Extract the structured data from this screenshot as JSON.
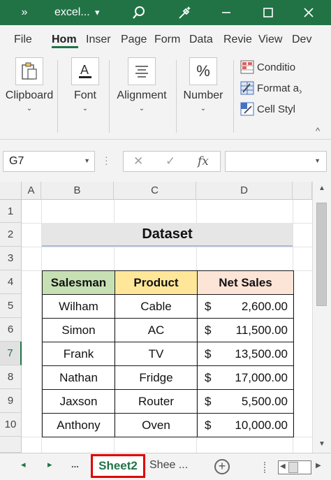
{
  "titlebar": {
    "overflow_glyph": "»",
    "filename": "excel...",
    "dropdown_glyph": "▾",
    "icons": [
      "search-icon",
      "wand-icon",
      "minimize-icon",
      "restore-icon",
      "close-icon"
    ]
  },
  "ribbon_tabs": [
    {
      "label": "File"
    },
    {
      "label": "Hom",
      "active": true
    },
    {
      "label": "Inser"
    },
    {
      "label": "Page"
    },
    {
      "label": "Form"
    },
    {
      "label": "Data"
    },
    {
      "label": "Revie"
    },
    {
      "label": "View"
    },
    {
      "label": "Dev"
    }
  ],
  "ribbon": {
    "clipboard": "Clipboard",
    "font": "Font",
    "alignment": "Alignment",
    "number": "Number",
    "number_symbol": "%",
    "conditional": "Conditio",
    "format_as": "Format a",
    "cell_styles": "Cell Styl",
    "collapse_glyph": "^",
    "expand_glyph": "›"
  },
  "formula_bar": {
    "name_box": "G7",
    "cancel_glyph": "✕",
    "enter_glyph": "✓",
    "fx_glyph": "fx",
    "formula_value": ""
  },
  "grid": {
    "columns": [
      "A",
      "B",
      "C",
      "D"
    ],
    "rows": [
      "1",
      "2",
      "3",
      "4",
      "5",
      "6",
      "7",
      "8",
      "9",
      "10"
    ],
    "selected_row": "7"
  },
  "dataset": {
    "title": "Dataset",
    "headers": [
      "Salesman",
      "Product",
      "Net Sales"
    ],
    "header_colors": [
      "#c6e0b4",
      "#ffe699",
      "#fce4d6"
    ],
    "currency_symbol": "$",
    "rows": [
      {
        "salesman": "Wilham",
        "product": "Cable",
        "net_sales": "2,600.00"
      },
      {
        "salesman": "Simon",
        "product": "AC",
        "net_sales": "11,500.00"
      },
      {
        "salesman": "Frank",
        "product": "TV",
        "net_sales": "13,500.00"
      },
      {
        "salesman": "Nathan",
        "product": "Fridge",
        "net_sales": "17,000.00"
      },
      {
        "salesman": "Jaxson",
        "product": "Router",
        "net_sales": "5,500.00"
      },
      {
        "salesman": "Anthony",
        "product": "Oven",
        "net_sales": "10,000.00"
      }
    ]
  },
  "sheets": {
    "prev_glyph": "◂",
    "next_glyph": "▸",
    "more_left": "...",
    "active_tab": "Sheet2",
    "other_tab": "Shee ...",
    "add_glyph": "+",
    "accent_color": "#217346",
    "highlight_color": "#e00000"
  }
}
